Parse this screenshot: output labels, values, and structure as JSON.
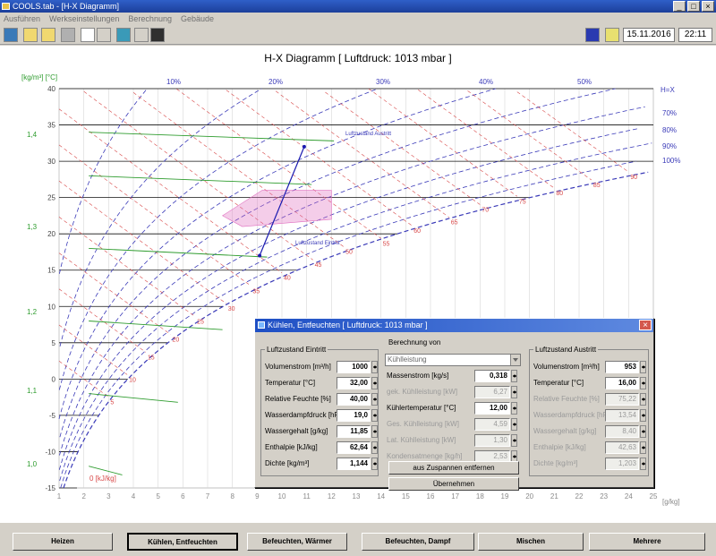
{
  "window": {
    "title": "COOLS.tab - [H-X Diagramm]"
  },
  "menu": [
    "Ausführen",
    "Werkseinstellungen",
    "Berechnung",
    "Gebäude"
  ],
  "toolbar": {
    "date": "15.11.2016",
    "time": "22:11"
  },
  "chart": {
    "title": "H-X Diagramm   [ Luftdruck: 1013 mbar ]",
    "y_left_label": "[kg/m³] [°C]",
    "x_unit_label": "[g/kg]",
    "enthalpy_axis_label": "0 [kJ/kg]",
    "h_x_label": "H=X",
    "rh_top_labels": [
      "10%",
      "20%",
      "30%",
      "40%",
      "50%"
    ],
    "rh_right_labels": [
      "70%",
      "80%",
      "90%",
      "100%"
    ],
    "density_labels": [
      "1,4",
      "1,3",
      "1,2",
      "1,1",
      "1,0"
    ],
    "process_point_labels": [
      "Luftzustand Austritt",
      "Luftzustand Eintritt"
    ]
  },
  "chart_data": {
    "type": "line",
    "title": "H-X Diagramm   [ Luftdruck: 1013 mbar ]",
    "xlabel": "[g/kg]",
    "ylabel": "[°C]",
    "xlim": [
      1,
      25
    ],
    "ylim": [
      -15,
      40
    ],
    "x_ticks": [
      1,
      2,
      3,
      4,
      5,
      6,
      7,
      8,
      9,
      10,
      11,
      12,
      13,
      14,
      15,
      16,
      17,
      18,
      19,
      20,
      21,
      22,
      23,
      24,
      25
    ],
    "y_ticks": [
      40,
      35,
      30,
      25,
      20,
      15,
      10,
      5,
      0,
      -5,
      -10,
      -15
    ],
    "enthalpy_ticks": [
      5,
      10,
      15,
      20,
      25,
      30,
      35,
      40,
      45,
      50,
      55,
      60,
      65,
      70,
      75,
      80,
      85,
      90
    ],
    "series": [
      {
        "name": "Luftzustand Eintritt",
        "x": [
          10.9
        ],
        "y": [
          32.0
        ]
      },
      {
        "name": "Luftzustand Austritt",
        "x": [
          10.9
        ],
        "y": [
          17.0
        ]
      }
    ],
    "comfort_zone": {
      "x": [
        8,
        12
      ],
      "y": [
        22,
        26
      ]
    },
    "grid": true
  },
  "dialog": {
    "title": "Kühlen, Entfeuchten  [ Luftdruck: 1013 mbar ]",
    "close": "×",
    "entry": {
      "legend": "Luftzustand Eintritt",
      "rows": [
        {
          "label": "Volumenstrom [m³/h]",
          "value": "1000",
          "enabled": true
        },
        {
          "label": "Temperatur [°C]",
          "value": "32,00",
          "enabled": true
        },
        {
          "label": "Relative Feuchte [%]",
          "value": "40,00",
          "enabled": true
        },
        {
          "label": "Wasserdampfdruck [hPa]",
          "value": "19,0",
          "enabled": true
        },
        {
          "label": "Wassergehalt [g/kg]",
          "value": "11,85",
          "enabled": true
        },
        {
          "label": "Enthalpie [kJ/kg]",
          "value": "62,64",
          "enabled": true
        },
        {
          "label": "Dichte [kg/m³]",
          "value": "1,144",
          "enabled": true
        }
      ]
    },
    "calc": {
      "legend": "Berechnung von",
      "selected": "Kühlleistung",
      "rows": [
        {
          "label": "Massenstrom [kg/s]",
          "value": "0,318",
          "enabled": true
        },
        {
          "label": "gek. Kühlleistung [kW]",
          "value": "6,27",
          "enabled": false
        },
        {
          "label": "Kühlertemperatur [°C]",
          "value": "12,00",
          "enabled": true
        },
        {
          "label": "Ges. Kühlleistung [kW]",
          "value": "4,59",
          "enabled": false
        },
        {
          "label": "Lat. Kühlleistung [kW]",
          "value": "1,30",
          "enabled": false
        },
        {
          "label": "Kondensatmenge [kg/h]",
          "value": "2,53",
          "enabled": false
        }
      ],
      "btn_zuspannen": "aus Zuspannen entfernen",
      "btn_uebernehmen": "Übernehmen"
    },
    "exit": {
      "legend": "Luftzustand Austritt",
      "rows": [
        {
          "label": "Volumenstrom [m³/h]",
          "value": "953",
          "enabled": true
        },
        {
          "label": "Temperatur [°C]",
          "value": "16,00",
          "enabled": true
        },
        {
          "label": "Relative Feuchte [%]",
          "value": "75,22",
          "enabled": false
        },
        {
          "label": "Wasserdampfdruck [hPa]",
          "value": "13,54",
          "enabled": false
        },
        {
          "label": "Wassergehalt [g/kg]",
          "value": "8,40",
          "enabled": false
        },
        {
          "label": "Enthalpie [kJ/kg]",
          "value": "42,63",
          "enabled": false
        },
        {
          "label": "Dichte [kg/m³]",
          "value": "1,203",
          "enabled": false
        }
      ]
    }
  },
  "bottom_buttons": [
    "Heizen",
    "Kühlen, Entfeuchten",
    "Befeuchten, Wärmer",
    "Befeuchten, Dampf",
    "Mischen",
    "Mehrere"
  ],
  "colors": {
    "rh_curve": "#3a3ab8",
    "enthalpy": "#d84848",
    "density": "#2e9c2e",
    "temperature": "#101010",
    "comfort": "#e070c0"
  }
}
